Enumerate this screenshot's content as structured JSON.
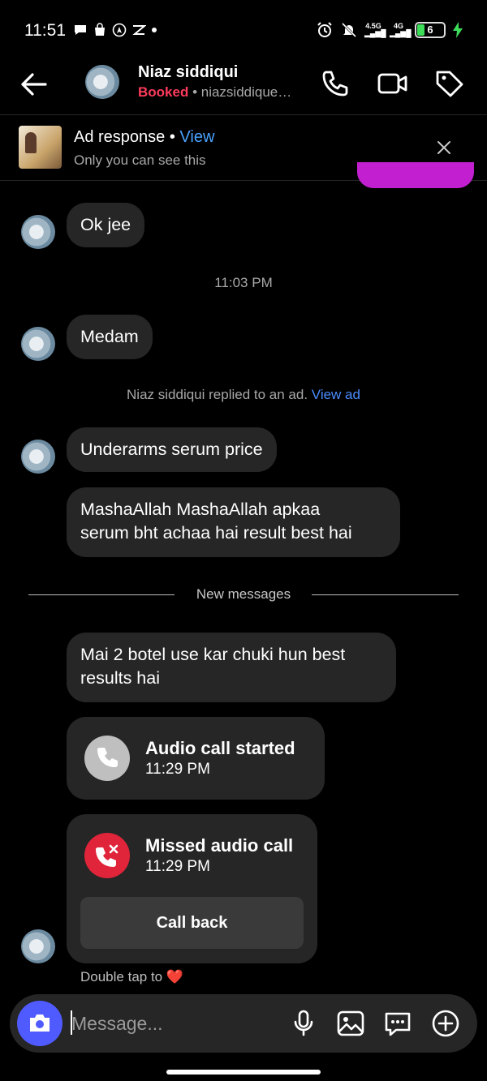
{
  "status_bar": {
    "time": "11:51",
    "network_a": "4.5G",
    "network_b": "4G",
    "battery_level": "6"
  },
  "header": {
    "name": "Niaz siddiqui",
    "status": "Booked",
    "subtitle": " • niazsiddique…"
  },
  "ad_banner": {
    "title": "Ad response",
    "separator": " • ",
    "view_label": "View",
    "note": "Only you can see this"
  },
  "messages": [
    {
      "text": "Ok jee"
    },
    {
      "text": "Medam"
    },
    {
      "text": "Underarms serum price"
    },
    {
      "line1": "MashaAllah MashaAllah apkaa",
      "line2": "serum bht achaa hai result best hai"
    },
    {
      "line1": "Mai 2 botel use kar chuki hun best",
      "line2": "results hai"
    }
  ],
  "timestamp": "11:03 PM",
  "ad_reply": {
    "text": "Niaz siddiqui replied to an ad. ",
    "link": "View ad"
  },
  "new_messages_label": "New messages",
  "calls": [
    {
      "title": "Audio call started",
      "time": "11:29 PM"
    },
    {
      "title": "Missed audio call",
      "time": "11:29 PM",
      "action": "Call back"
    }
  ],
  "reaction_hint": {
    "text": "Double tap to",
    "emoji": "❤️"
  },
  "composer": {
    "placeholder": "Message..."
  },
  "colors": {
    "accent_blue": "#4aa2ff",
    "booked_red": "#ff3b5c",
    "camera_button": "#4f5bff",
    "missed_call_red": "#e0243a",
    "bubble_bg": "#262626"
  }
}
